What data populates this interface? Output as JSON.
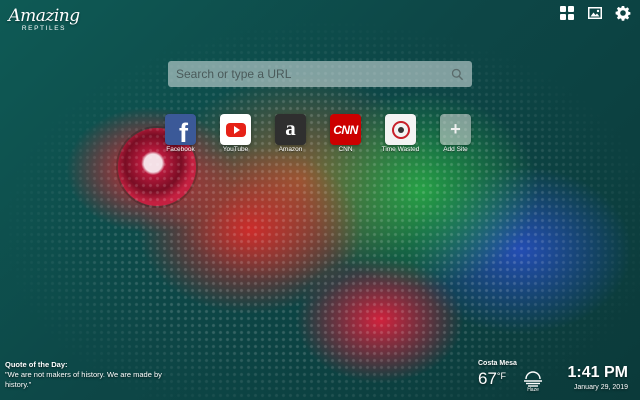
{
  "logo": {
    "title": "Amazing",
    "subtitle": "REPTILES"
  },
  "top_icons": [
    {
      "name": "apps-grid-icon",
      "label": "Apps"
    },
    {
      "name": "wallpaper-icon",
      "label": "Wallpaper"
    },
    {
      "name": "settings-gear-icon",
      "label": "Settings"
    }
  ],
  "search": {
    "placeholder": "Search or type a URL"
  },
  "speed_dials": [
    {
      "label": "Facebook"
    },
    {
      "label": "YouTube"
    },
    {
      "label": "Amazon"
    },
    {
      "label": "CNN"
    },
    {
      "label": "Time Wasted"
    },
    {
      "label": "Add Site"
    }
  ],
  "quote": {
    "heading": "Quote of the Day:",
    "text": "\"We are not makers of history. We are made by history.\""
  },
  "weather": {
    "city": "Costa Mesa",
    "temperature": "67",
    "unit": "°F",
    "condition": "Haze"
  },
  "clock": {
    "time": "1:41 PM",
    "date": "January 29, 2019"
  }
}
